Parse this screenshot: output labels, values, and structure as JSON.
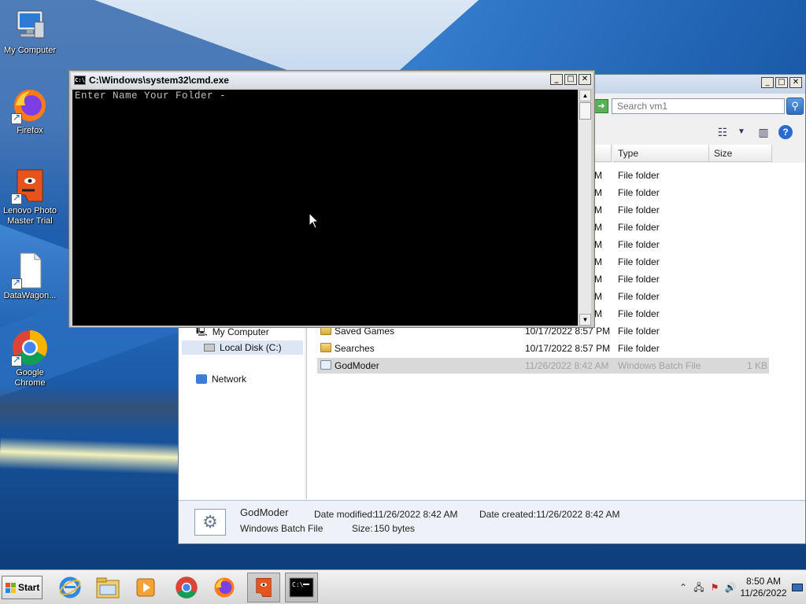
{
  "desktop": {
    "icons": [
      {
        "label": "My Computer",
        "icon": "my-computer-icon"
      },
      {
        "label": "Firefox",
        "icon": "firefox-icon"
      },
      {
        "label": "Lenovo Photo Master Trial",
        "icon": "lenovo-photo-master-icon"
      },
      {
        "label": "DataWagon...",
        "icon": "file-icon"
      },
      {
        "label": "Google Chrome",
        "icon": "chrome-icon"
      }
    ]
  },
  "cmd_window": {
    "title": "C:\\Windows\\system32\\cmd.exe",
    "title_icon_text": "C:\\",
    "output": "Enter Name Your Folder -"
  },
  "explorer": {
    "search_placeholder": "Search vm1",
    "columns": {
      "type": "Type",
      "size": "Size"
    },
    "nav": {
      "my_computer": "My Computer",
      "local_disk": "Local Disk (C:)",
      "network": "Network"
    },
    "rows_partial": [
      {
        "date_tail": "M",
        "type": "File folder"
      },
      {
        "date_tail": "M",
        "type": "File folder"
      },
      {
        "date_tail": "M",
        "type": "File folder"
      },
      {
        "date_tail": "M",
        "type": "File folder"
      },
      {
        "date_tail": "M",
        "type": "File folder"
      },
      {
        "date_tail": "M",
        "type": "File folder"
      },
      {
        "date_tail": "M",
        "type": "File folder"
      },
      {
        "date_tail": "M",
        "type": "File folder"
      },
      {
        "date_tail": "M",
        "type": "File folder"
      }
    ],
    "rows": [
      {
        "name": "Saved Games",
        "date": "10/17/2022 8:57 PM",
        "type": "File folder",
        "size": ""
      },
      {
        "name": "Searches",
        "date": "10/17/2022 8:57 PM",
        "type": "File folder",
        "size": ""
      },
      {
        "name": "GodModer",
        "date": "11/26/2022 8:42 AM",
        "type": "Windows Batch File",
        "size": "1 KB"
      }
    ],
    "details": {
      "name": "GodModer",
      "type": "Windows Batch File",
      "date_modified_label": "Date modified:",
      "date_modified": "11/26/2022 8:42 AM",
      "date_created_label": "Date created:",
      "date_created": "11/26/2022 8:42 AM",
      "size_label": "Size:",
      "size": "150 bytes"
    }
  },
  "taskbar": {
    "start_label": "Start",
    "apps": [
      "internet-explorer-icon",
      "file-explorer-icon",
      "media-player-icon",
      "chrome-icon",
      "firefox-icon",
      "lenovo-photo-master-icon",
      "cmd-icon"
    ],
    "clock_time": "8:50 AM",
    "clock_date": "11/26/2022"
  }
}
